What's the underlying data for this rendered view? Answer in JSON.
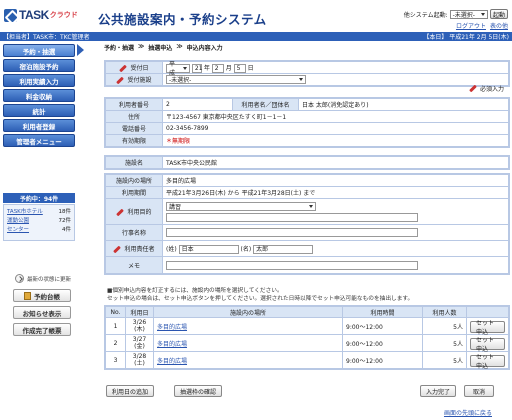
{
  "header": {
    "logo_text": "TASK",
    "logo_sub": "クラウド",
    "system_title": "公共施設案内・予約システム",
    "start_label": "他システム起動:",
    "start_select": "-未選択-",
    "start_button": "起動",
    "logout": "ログアウト",
    "others": "表の他"
  },
  "bar": {
    "left": "【担当者】TASK市：TKC管理者",
    "right": "【本日】 平成21年 2月 5日(木)"
  },
  "sidebar": {
    "items": [
      {
        "label": "予約・抽選"
      },
      {
        "label": "宿泊施設予約"
      },
      {
        "label": "利用実績入力"
      },
      {
        "label": "料金収納"
      },
      {
        "label": "統計"
      },
      {
        "label": "利用者登録"
      },
      {
        "label": "管理者メニュー"
      }
    ],
    "reservation_count": "予約中：94件",
    "reservations": [
      {
        "name": "TASK市ホテル",
        "count": "18件"
      },
      {
        "name": "運動公園",
        "count": "72件"
      },
      {
        "name": "センター",
        "count": "4件"
      }
    ],
    "refresh": "最新の状態に更新",
    "btn_ledger": "予約台帳",
    "btn_notice": "お知らせ表示",
    "btn_report": "作成完了帳票"
  },
  "breadcrumb": [
    "予約・抽選",
    "≫",
    "抽選申込",
    "≫",
    "申込内容入力"
  ],
  "form": {
    "reception_date_label": "受付日",
    "era": "平成",
    "year": "21",
    "year_unit": "年",
    "month": "2",
    "month_unit": "月",
    "day": "5",
    "day_unit": "日",
    "reception_facility_label": "受付施設",
    "reception_facility_value": "-未選択-",
    "required_note": "必須入力"
  },
  "user": {
    "no_label": "利用者番号",
    "no_value": "2",
    "name_label": "利用者名／団体名",
    "name_value": "日本 太郎(消免認定あり)",
    "address_label": "住所",
    "address_value": "〒123-4567 東京都中央区たすく町1－1－1",
    "phone_label": "電話番号",
    "phone_value": "02-3456-7899",
    "expiry_label": "有効期限",
    "expiry_value": "＊無期限"
  },
  "facility": {
    "label": "施設名",
    "value": "TASK市中央公民館"
  },
  "detail": {
    "room_label": "施設内の場所",
    "room_value": "多目的広場",
    "period_label": "利用期間",
    "period_value": "平成21年3月26日(木) から 平成21年3月28日(土) まで",
    "purpose_label": "利用目的",
    "purpose_value": "講習",
    "event_label": "行事名称",
    "person_label": "利用責任者",
    "last_prefix": "(姓)",
    "last_value": "日本",
    "first_prefix": "(名)",
    "first_value": "太郎",
    "memo_label": "メモ"
  },
  "note": {
    "line1": "■個別申込内容を訂正するには、施設内の場所を選択してください。",
    "line2": "セット申込の場合は、セット申込ボタンを押してください。選択された日時以降でセット申込可能なものを抽出します。"
  },
  "table": {
    "headers": [
      "No.",
      "利用日",
      "施設内の場所",
      "利用時間",
      "利用人数",
      ""
    ],
    "rows": [
      {
        "no": "1",
        "date1": "3/26",
        "date2": "(木)",
        "place": "多目的広場",
        "time": "9:00～12:00",
        "people": "5人",
        "btn": "セット申込"
      },
      {
        "no": "2",
        "date1": "3/27",
        "date2": "(金)",
        "place": "多目的広場",
        "time": "9:00～12:00",
        "people": "5人",
        "btn": "セット申込"
      },
      {
        "no": "3",
        "date1": "3/28",
        "date2": "(土)",
        "place": "多目的広場",
        "time": "9:00～12:00",
        "people": "5人",
        "btn": "セット申込"
      }
    ]
  },
  "footer": {
    "add_date": "利用日の追加",
    "check_frame": "抽選枠の確認",
    "complete": "入力完了",
    "cancel": "取消",
    "to_top": "画面の先頭に戻る"
  }
}
